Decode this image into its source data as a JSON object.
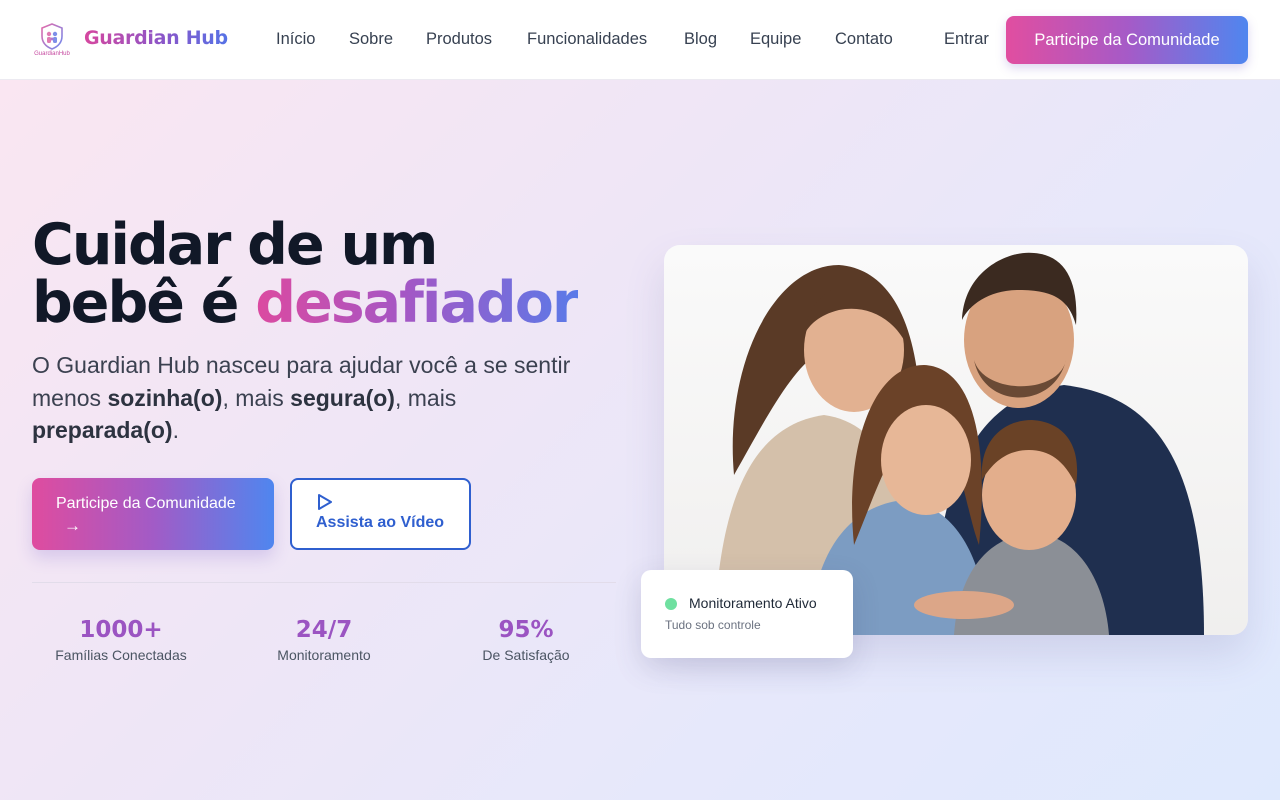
{
  "brand": {
    "name": "Guardian Hub",
    "logo_caption": "GuardianHub",
    "logo_icon": "family-shield-icon",
    "colors": {
      "pink": "#e14ea0",
      "purple": "#a65ac7",
      "blue": "#4f86ef"
    }
  },
  "nav": {
    "items": [
      {
        "label": "Início"
      },
      {
        "label": "Sobre"
      },
      {
        "label": "Produtos"
      },
      {
        "label": "Funcionalidades"
      },
      {
        "label": "Blog"
      },
      {
        "label": "Equipe"
      },
      {
        "label": "Contato"
      }
    ],
    "login_label": "Entrar",
    "cta_label": "Participe da Comunidade"
  },
  "hero": {
    "headline_line1": "Cuidar de um",
    "headline_line2_plain": "bebê é ",
    "headline_line2_highlight": "desafiador",
    "lead": {
      "part1": "O Guardian Hub nasceu para ajudar você a se sentir menos ",
      "bold1": "sozinha(o)",
      "part2": ", mais ",
      "bold2": "segura(o)",
      "part3": ", mais ",
      "bold3": "preparada(o)",
      "part4": "."
    },
    "primary_button": {
      "label": "Participe da Comunidade",
      "icon": "arrow-right-icon",
      "glyph": "→"
    },
    "secondary_button": {
      "label": "Assista ao Vídeo",
      "icon": "play-icon"
    },
    "stats": [
      {
        "value": "1000+",
        "label": "Famílias Conectadas"
      },
      {
        "value": "24/7",
        "label": "Monitoramento"
      },
      {
        "value": "95%",
        "label": "De Satisfação"
      }
    ]
  },
  "image_card": {
    "subject": "family-photo",
    "status": {
      "title": "Monitoramento Ativo",
      "subtitle": "Tudo sob controle",
      "dot_color": "#6fe0a0"
    }
  }
}
